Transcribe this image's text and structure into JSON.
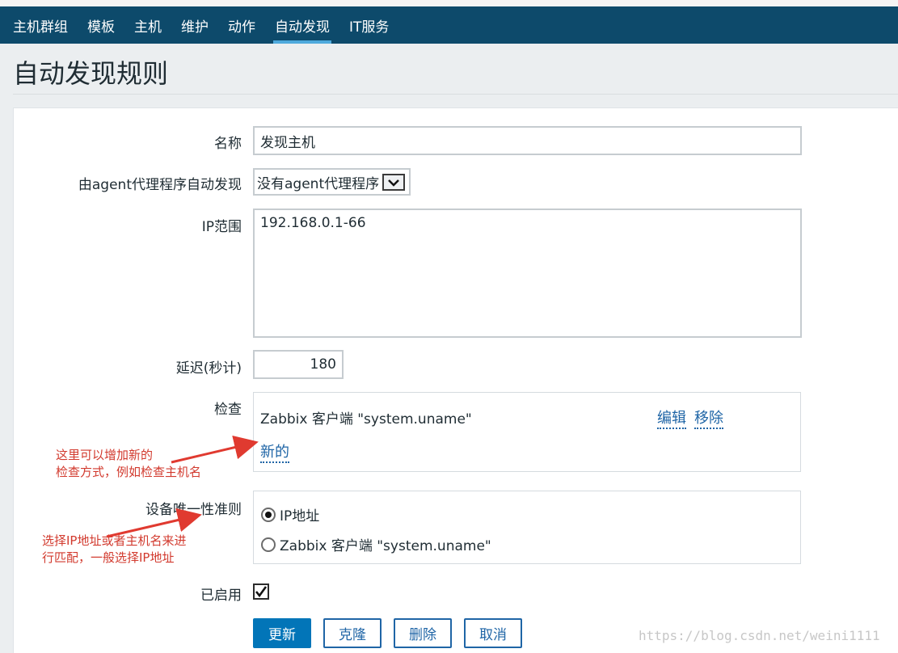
{
  "nav": {
    "items": [
      {
        "label": "主机群组",
        "active": false
      },
      {
        "label": "模板",
        "active": false
      },
      {
        "label": "主机",
        "active": false
      },
      {
        "label": "维护",
        "active": false
      },
      {
        "label": "动作",
        "active": false
      },
      {
        "label": "自动发现",
        "active": true
      },
      {
        "label": "IT服务",
        "active": false
      }
    ]
  },
  "page": {
    "title": "自动发现规则"
  },
  "form": {
    "name": {
      "label": "名称",
      "value": "发现主机"
    },
    "proxy": {
      "label": "由agent代理程序自动发现",
      "selected": "没有agent代理程序"
    },
    "ip_range": {
      "label": "IP范围",
      "value": "192.168.0.1-66"
    },
    "delay": {
      "label": "延迟(秒计)",
      "value": "180"
    },
    "checks": {
      "label": "检查",
      "items": [
        {
          "text": "Zabbix 客户端 \"system.uname\"",
          "edit": "编辑",
          "remove": "移除"
        }
      ],
      "new_link": "新的"
    },
    "uniqueness": {
      "label": "设备唯一性准则",
      "options": [
        {
          "label": "IP地址",
          "checked": true
        },
        {
          "label": "Zabbix 客户端 \"system.uname\"",
          "checked": false
        }
      ]
    },
    "enabled": {
      "label": "已启用",
      "checked": true
    }
  },
  "buttons": {
    "update": "更新",
    "clone": "克隆",
    "delete": "删除",
    "cancel": "取消"
  },
  "annotations": {
    "checks_note": [
      "这里可以增加新的",
      "检查方式，例如检查主机名"
    ],
    "uniqueness_note": [
      "选择IP地址或者主机名来进",
      "行匹配，一般选择IP地址"
    ]
  },
  "watermark": "https://blog.csdn.net/weini1111",
  "colors": {
    "nav_bg": "#0d4a6b",
    "active_underline": "#4ea9dc",
    "primary": "#0275b8",
    "link": "#1f65a6",
    "annotation": "#d23a2e"
  }
}
